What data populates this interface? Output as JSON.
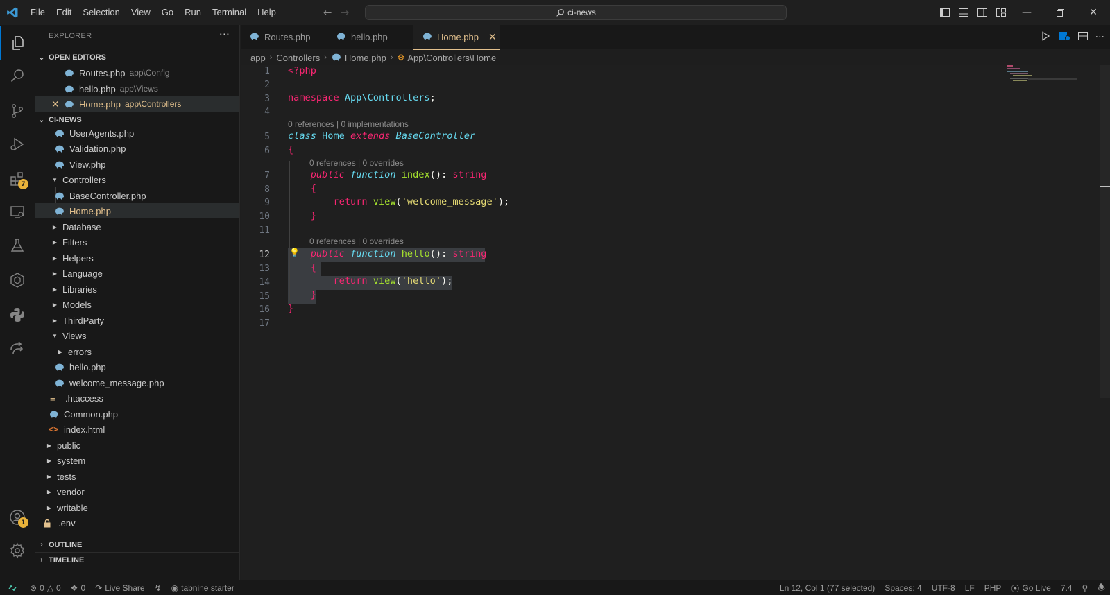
{
  "titlebar": {
    "menus": [
      "File",
      "Edit",
      "Selection",
      "View",
      "Go",
      "Run",
      "Terminal",
      "Help"
    ],
    "command_center": "ci-news"
  },
  "activity": {
    "extensions_badge": "7",
    "accounts_badge": "1"
  },
  "sidebar": {
    "title": "EXPLORER",
    "open_editors_header": "OPEN EDITORS",
    "open_editors": [
      {
        "name": "Routes.php",
        "desc": "app\\Config"
      },
      {
        "name": "hello.php",
        "desc": "app\\Views"
      },
      {
        "name": "Home.php",
        "desc": "app\\Controllers"
      }
    ],
    "project_header": "CI-NEWS",
    "tree": [
      "UserAgents.php",
      "Validation.php",
      "View.php",
      "Controllers",
      "BaseController.php",
      "Home.php",
      "Database",
      "Filters",
      "Helpers",
      "Language",
      "Libraries",
      "Models",
      "ThirdParty",
      "Views",
      "errors",
      "hello.php",
      "welcome_message.php",
      ".htaccess",
      "Common.php",
      "index.html",
      "public",
      "system",
      "tests",
      "vendor",
      "writable",
      ".env"
    ],
    "outline_header": "OUTLINE",
    "timeline_header": "TIMELINE"
  },
  "tabs": [
    {
      "label": "Routes.php"
    },
    {
      "label": "hello.php"
    },
    {
      "label": "Home.php"
    }
  ],
  "breadcrumb": {
    "part1": "app",
    "part2": "Controllers",
    "part3": "Home.php",
    "part4": "App\\Controllers\\Home"
  },
  "editor": {
    "line_numbers": [
      "1",
      "2",
      "3",
      "4",
      "5",
      "6",
      "7",
      "8",
      "9",
      "10",
      "11",
      "12",
      "13",
      "14",
      "15",
      "16",
      "17"
    ],
    "codelens": {
      "class": "0 references | 0 implementations",
      "index": "0 references | 0 overrides",
      "hello": "0 references | 0 overrides"
    },
    "code": {
      "php_open": "<?php",
      "kw_namespace": "namespace",
      "ns_name": "App\\Controllers",
      "semi": ";",
      "kw_class": "class",
      "class_name": "Home",
      "kw_extends": "extends",
      "base_class": "BaseController",
      "brace_open": "{",
      "brace_close": "}",
      "kw_public": "public",
      "kw_function": "function",
      "fn_index": "index",
      "fn_hello": "hello",
      "sig_suffix": "(): ",
      "type_string": "string",
      "kw_return": "return",
      "fn_view": "view",
      "paren_open": "(",
      "str_welcome": "'welcome_message'",
      "str_hello": "'hello'",
      "paren_close_semi": ");"
    }
  },
  "statusbar": {
    "errors": "0",
    "warnings": "0",
    "ports": "0",
    "live_share": "Live Share",
    "tabnine": "tabnine starter",
    "position": "Ln 12, Col 1 (77 selected)",
    "spaces": "Spaces: 4",
    "encoding": "UTF-8",
    "eol": "LF",
    "language": "PHP",
    "go_live": "Go Live",
    "php_version": "7.4"
  },
  "colors": {
    "accent": "#0078d4",
    "modified": "#e2c08d",
    "php_icon": "#7fb3d5"
  }
}
